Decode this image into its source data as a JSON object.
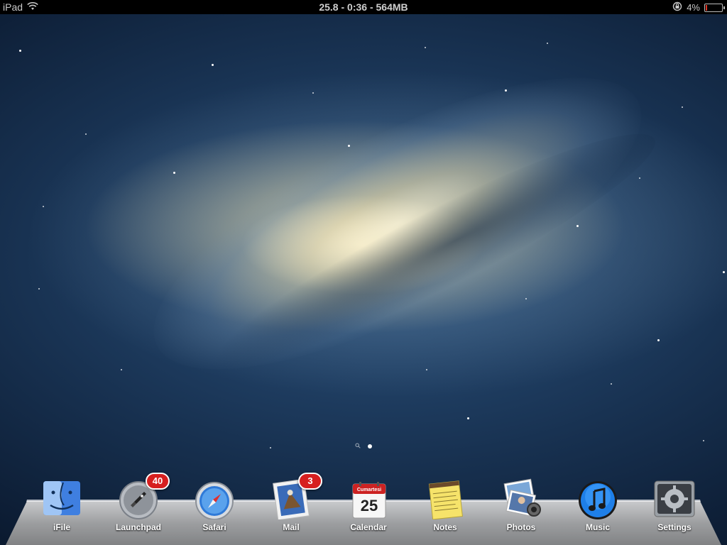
{
  "status_bar": {
    "device": "iPad",
    "center_text": "25.8 - 0:36 - 564MB",
    "battery_percent": "4%",
    "battery_level": 0.04,
    "icons": [
      "wifi-icon",
      "orientation-lock-icon",
      "battery-icon"
    ]
  },
  "page_indicator": {
    "pages": 2,
    "current": 1,
    "search_icon": "search-icon"
  },
  "dock": {
    "items": [
      {
        "label": "iFile",
        "icon": "finder-icon",
        "badge": ""
      },
      {
        "label": "Launchpad",
        "icon": "rocket-icon",
        "badge": "40"
      },
      {
        "label": "Safari",
        "icon": "compass-icon",
        "badge": ""
      },
      {
        "label": "Mail",
        "icon": "stamp-icon",
        "badge": "3"
      },
      {
        "label": "Calendar",
        "icon": "calendar-icon",
        "badge": "",
        "month_text": "Cumartesi",
        "day_text": "25"
      },
      {
        "label": "Notes",
        "icon": "notepad-icon",
        "badge": ""
      },
      {
        "label": "Photos",
        "icon": "photos-icon",
        "badge": ""
      },
      {
        "label": "Music",
        "icon": "music-note-icon",
        "badge": ""
      },
      {
        "label": "Settings",
        "icon": "gear-icon",
        "badge": ""
      }
    ]
  },
  "colors": {
    "badge": "#d61f1f",
    "status_bar": "#000000",
    "sky": "#17304f"
  }
}
